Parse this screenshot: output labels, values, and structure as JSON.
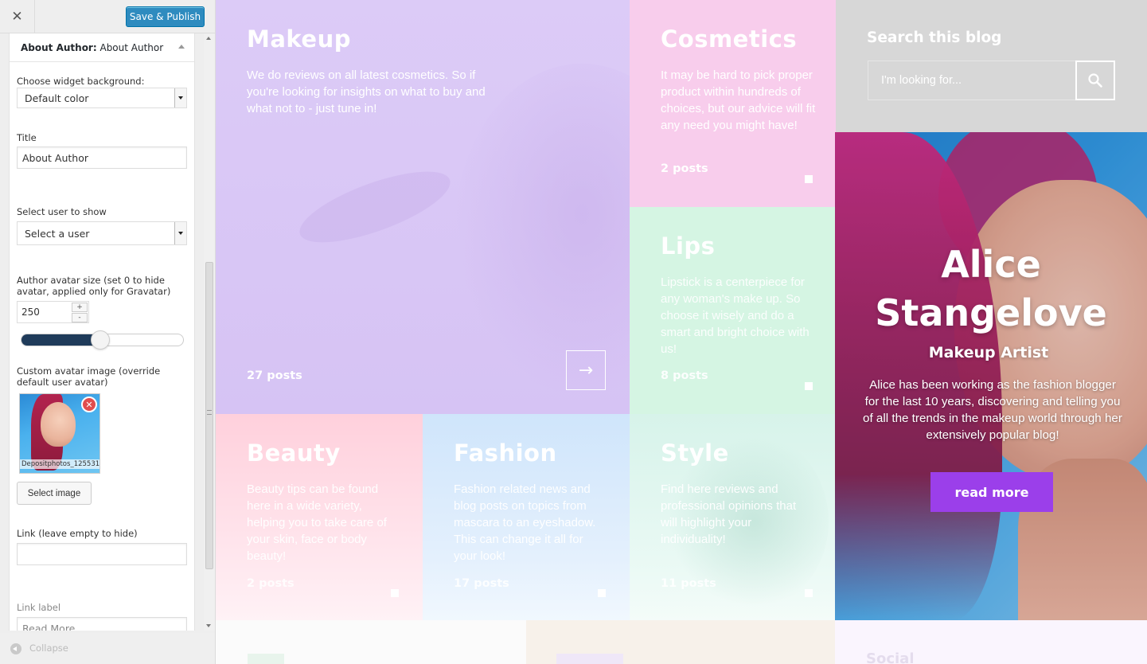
{
  "customizer": {
    "close_icon": "close-icon",
    "publish_label": "Save & Publish",
    "panel": {
      "title_prefix": "About Author:",
      "title_name": "About Author"
    },
    "fields": {
      "background_label": "Choose widget background:",
      "background_value": "Default color",
      "title_label": "Title",
      "title_value": "About Author",
      "user_label": "Select user to show",
      "user_value": "Select a user",
      "avatar_size_label": "Author avatar size (set 0 to hide avatar, applied only for Gravatar)",
      "avatar_size_value": "250",
      "avatar_size_slider_fraction": 0.49,
      "spin_up": "+",
      "spin_down": "-",
      "custom_avatar_label": "Custom avatar image (override default user avatar)",
      "avatar_caption": "Depositphotos_125531",
      "select_image_label": "Select image",
      "link_label": "Link (leave empty to hide)",
      "link_value": "",
      "link_text_label": "Link label",
      "link_text_value": "Read More"
    },
    "collapse_label": "Collapse"
  },
  "blog": {
    "tiles": [
      {
        "title": "Makeup",
        "desc": "We do reviews on all latest cosmetics. So if you're looking for insights on what to buy and what not to - just tune in!",
        "count": "27 posts"
      },
      {
        "title": "Cosmetics",
        "desc": "It may be hard to pick proper product within hundreds of choices, but our advice will fit any need you might have!",
        "count": "2 posts"
      },
      {
        "title": "Lips",
        "desc": "Lipstick is a centerpiece for any woman's make up. So choose it wisely and do a smart and bright choice with us!",
        "count": "8 posts"
      },
      {
        "title": "Beauty",
        "desc": "Beauty tips can be found here in a wide variety, helping you to take care of your skin, face or body beauty!",
        "count": "2 posts"
      },
      {
        "title": "Fashion",
        "desc": "Fashion related news and blog posts on topics from mascara to an eyeshadow. This can change it all for your look!",
        "count": "17 posts"
      },
      {
        "title": "Style",
        "desc": "Find here reviews and professional opinions that will highlight your individuality!",
        "count": "11 posts"
      }
    ],
    "arrow_icon": "arrow-right-icon",
    "search": {
      "title": "Search this blog",
      "placeholder": "I'm looking for...",
      "icon": "search-icon"
    },
    "author": {
      "name": "Alice Stangelove",
      "role": "Makeup Artist",
      "bio": "Alice has been working as the fashion blogger for the last 10 years, discovering and telling you of all the trends in the makeup world through her extensively popular blog!",
      "button": "read more",
      "button_color": "#9b3fea"
    },
    "bottom": {
      "social_title": "Social"
    }
  }
}
